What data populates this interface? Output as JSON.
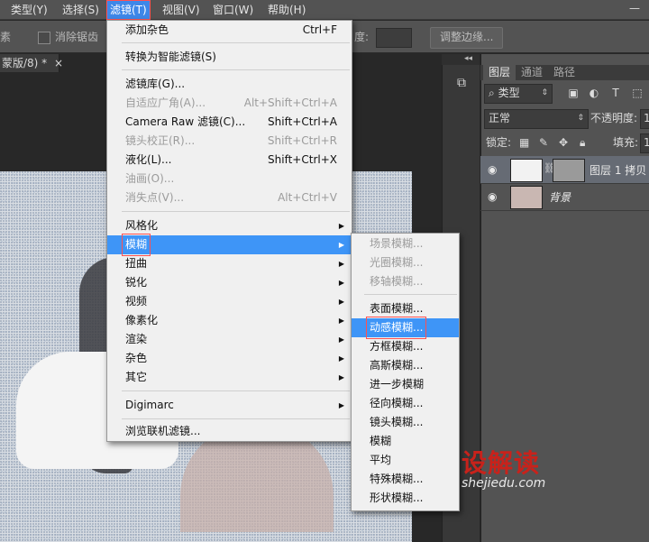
{
  "menubar": {
    "items": [
      "类型(Y)",
      "选择(S)",
      "滤镜(T)",
      "视图(V)",
      "窗口(W)",
      "帮助(H)"
    ],
    "open_item": "滤镜(T)",
    "minimize": "—"
  },
  "options_bar": {
    "partial_left": "素",
    "antialias_label": "消除锯齿",
    "partial_field_label": "度:",
    "refine_edge_button": "调整边缘..."
  },
  "document": {
    "tab_label": "蒙版/8) *",
    "close": "×"
  },
  "filter_menu": {
    "items": [
      {
        "label": "添加杂色",
        "shortcut": "Ctrl+F",
        "disabled": false
      },
      {
        "label": "转换为智能滤镜(S)",
        "shortcut": "",
        "disabled": false
      },
      {
        "label": "滤镜库(G)...",
        "shortcut": "",
        "disabled": false
      },
      {
        "label": "自适应广角(A)...",
        "shortcut": "Alt+Shift+Ctrl+A",
        "disabled": true
      },
      {
        "label": "Camera Raw 滤镜(C)...",
        "shortcut": "Shift+Ctrl+A",
        "disabled": false
      },
      {
        "label": "镜头校正(R)...",
        "shortcut": "Shift+Ctrl+R",
        "disabled": true
      },
      {
        "label": "液化(L)...",
        "shortcut": "Shift+Ctrl+X",
        "disabled": false
      },
      {
        "label": "油画(O)...",
        "shortcut": "",
        "disabled": true
      },
      {
        "label": "消失点(V)...",
        "shortcut": "Alt+Ctrl+V",
        "disabled": true
      },
      {
        "label": "风格化",
        "submenu": true
      },
      {
        "label": "模糊",
        "submenu": true,
        "highlighted": true
      },
      {
        "label": "扭曲",
        "submenu": true
      },
      {
        "label": "锐化",
        "submenu": true
      },
      {
        "label": "视频",
        "submenu": true
      },
      {
        "label": "像素化",
        "submenu": true
      },
      {
        "label": "渲染",
        "submenu": true
      },
      {
        "label": "杂色",
        "submenu": true
      },
      {
        "label": "其它",
        "submenu": true
      },
      {
        "label": "Digimarc",
        "submenu": true
      },
      {
        "label": "浏览联机滤镜...",
        "shortcut": "",
        "disabled": false
      }
    ],
    "submenu_arrow": "▶"
  },
  "blur_menu": {
    "items": [
      {
        "label": "场景模糊...",
        "disabled": true
      },
      {
        "label": "光圈模糊...",
        "disabled": true
      },
      {
        "label": "移轴模糊...",
        "disabled": true
      },
      {
        "label": "表面模糊...",
        "disabled": false
      },
      {
        "label": "动感模糊...",
        "disabled": false,
        "highlighted": true
      },
      {
        "label": "方框模糊...",
        "disabled": false
      },
      {
        "label": "高斯模糊...",
        "disabled": false
      },
      {
        "label": "进一步模糊",
        "disabled": false
      },
      {
        "label": "径向模糊...",
        "disabled": false
      },
      {
        "label": "镜头模糊...",
        "disabled": false
      },
      {
        "label": "模糊",
        "disabled": false
      },
      {
        "label": "平均",
        "disabled": false
      },
      {
        "label": "特殊模糊...",
        "disabled": false
      },
      {
        "label": "形状模糊...",
        "disabled": false
      }
    ]
  },
  "layers_panel": {
    "tabs": [
      "图层",
      "通道",
      "路径"
    ],
    "filter_kind": "类型",
    "search_glyph": "⌕",
    "blend_mode": "正常",
    "opacity_label": "不透明度:",
    "opacity_partial": "1",
    "lock_label": "锁定:",
    "fill_label": "填充:",
    "fill_partial": "1",
    "layers": [
      {
        "name": "图层 1 拷贝",
        "selected": true
      },
      {
        "name": "背景",
        "selected": false
      }
    ]
  },
  "watermark": {
    "logo": "设解读",
    "url": "shejiedu.com"
  },
  "colors": {
    "menu_highlight": "#3e95f7",
    "annotation_box": "#ff5050",
    "watermark_red": "#c8221b"
  }
}
